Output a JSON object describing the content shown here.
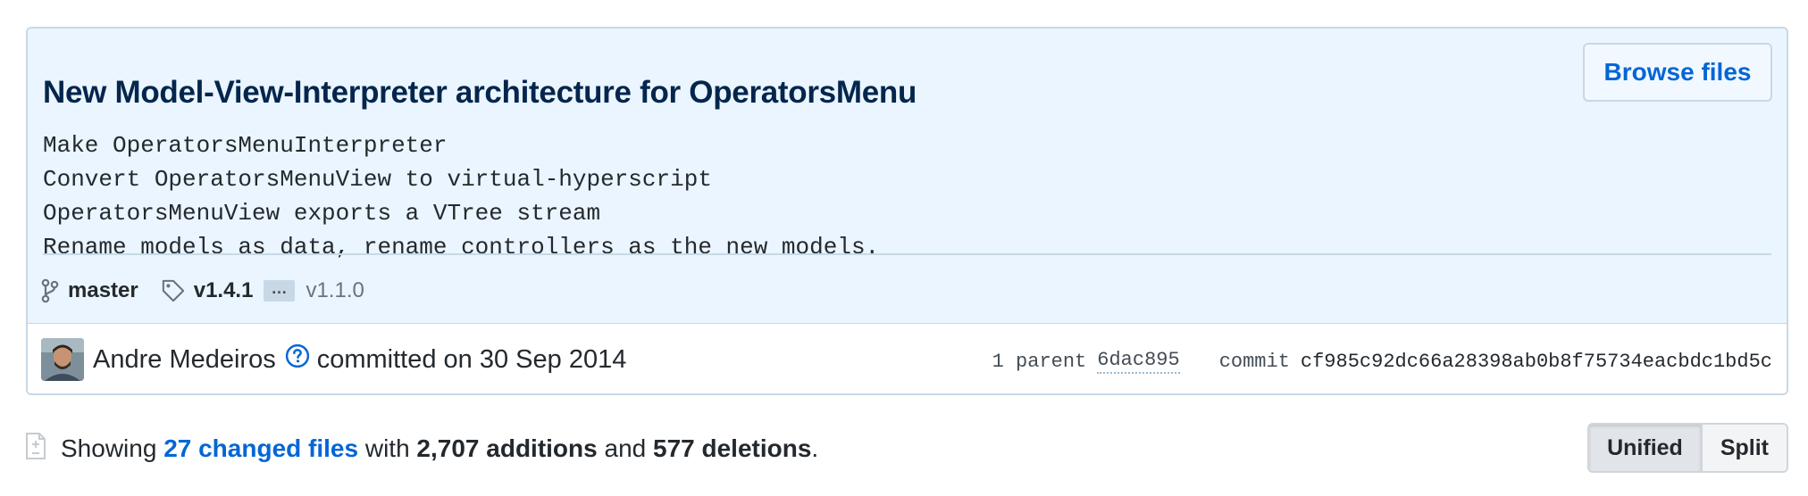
{
  "commit": {
    "title": "New Model-View-Interpreter architecture for OperatorsMenu",
    "browse_label": "Browse files",
    "description": [
      "Make OperatorsMenuInterpreter",
      "Convert OperatorsMenuView to virtual-hyperscript",
      "OperatorsMenuView exports a VTree stream",
      "Rename models as data, rename controllers as the new models."
    ],
    "branch": "master",
    "tag": "v1.4.1",
    "ellipsis": "…",
    "tag_oldest": "v1.1.0",
    "author": "Andre Medeiros",
    "committed_text": "committed on 30 Sep 2014",
    "parent_label": "1 parent",
    "parent_sha": "6dac895",
    "commit_label": "commit",
    "commit_sha": "cf985c92dc66a28398ab0b8f75734eacbdc1bd5c"
  },
  "summary": {
    "showing": "Showing ",
    "changed_files": "27 changed files",
    "with": " with ",
    "additions": "2,707 additions",
    "and": " and ",
    "deletions": "577 deletions",
    "period": "."
  },
  "view_toggle": {
    "unified": "Unified",
    "split": "Split",
    "selected": "Unified"
  },
  "colors": {
    "accent": "#0366d6",
    "header_bg": "#eaf5ff",
    "border": "#c8d8e6",
    "title": "#05264c"
  },
  "icons": [
    "git-branch-icon",
    "tag-icon",
    "question-icon",
    "file-diff-icon"
  ]
}
